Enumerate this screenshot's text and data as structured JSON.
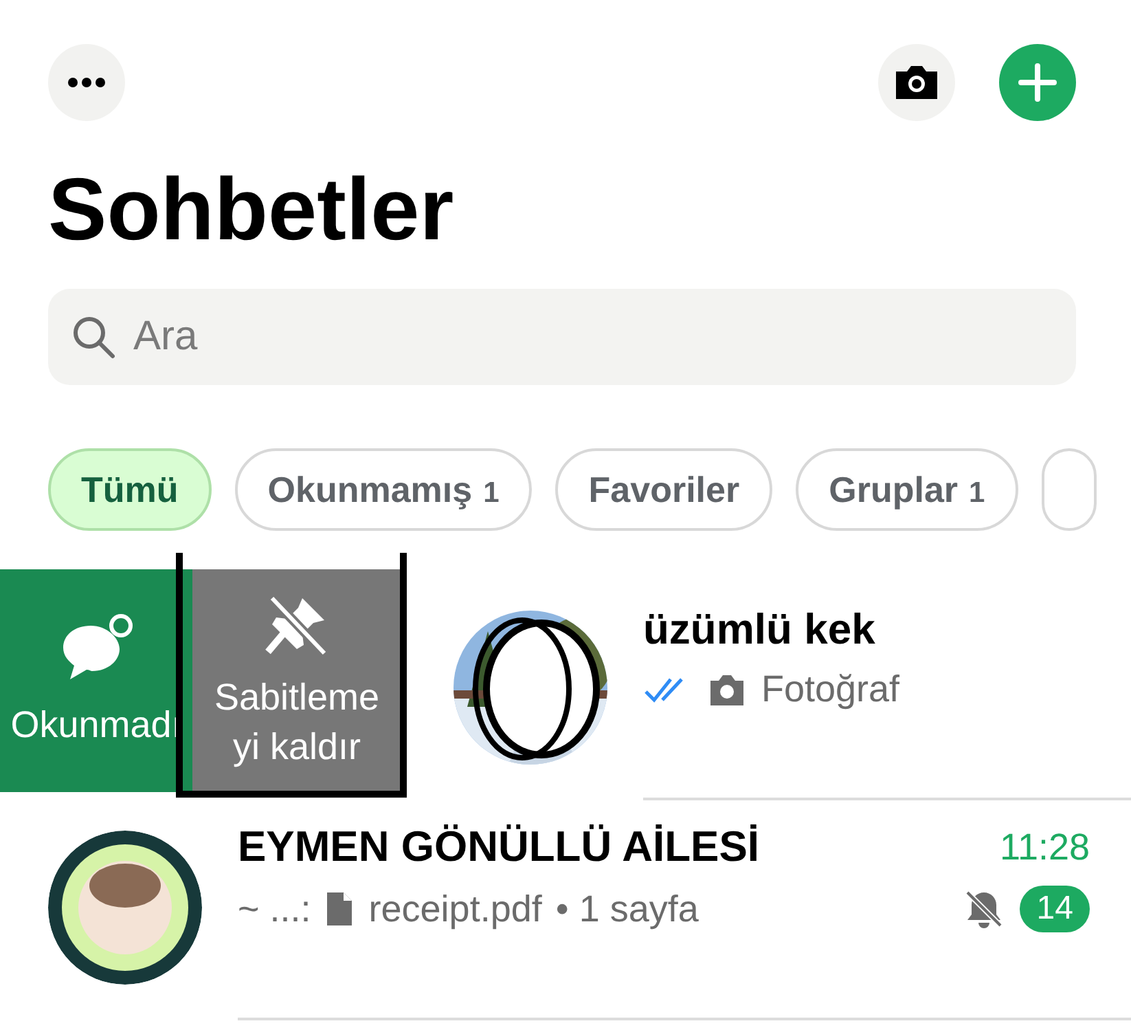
{
  "title": "Sohbetler",
  "search": {
    "placeholder": "Ara"
  },
  "filters": [
    {
      "label": "Tümü",
      "selected": true
    },
    {
      "label": "Okunmamış",
      "count": "1",
      "selected": false
    },
    {
      "label": "Favoriler",
      "selected": false
    },
    {
      "label": "Gruplar",
      "count": "1",
      "selected": false
    }
  ],
  "chats": [
    {
      "name": "üzümlü kek",
      "swiped": true,
      "actions": [
        {
          "kind": "unread",
          "label_lines": [
            "Okunmadı"
          ]
        },
        {
          "kind": "unpin",
          "label_lines": [
            "Sabitleme",
            "yi kaldır"
          ],
          "highlighted": true
        }
      ],
      "read": true,
      "message": {
        "text": "Fotoğraf"
      }
    },
    {
      "name": "EYMEN GÖNÜLLÜ AİLESİ",
      "swiped": false,
      "avatar": {
        "kind": "group"
      },
      "time": "11:28",
      "sender": "~ ...:",
      "message": {
        "kind": "document",
        "text": "receipt.pdf",
        "meta": "• 1 sayfa"
      },
      "muted": true,
      "unread_count": "14"
    }
  ]
}
